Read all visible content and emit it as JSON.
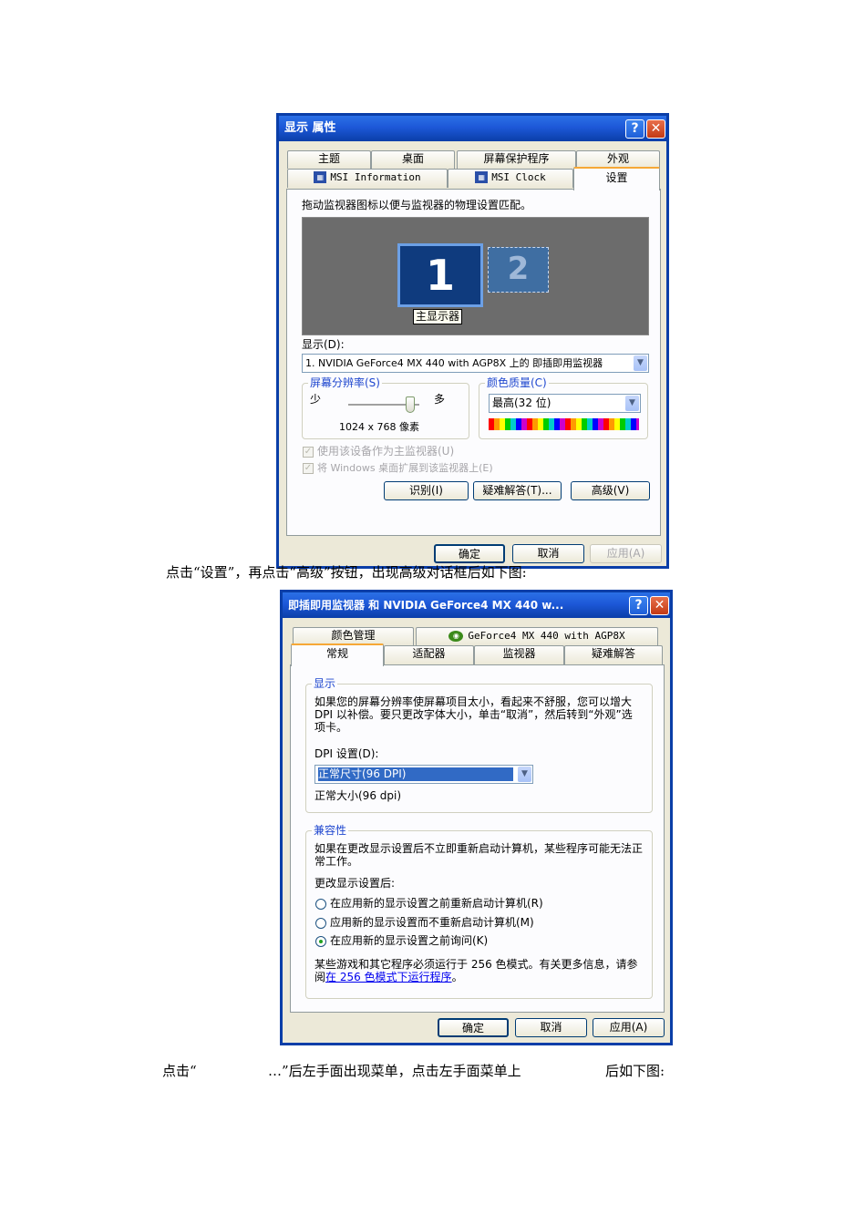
{
  "dialog1": {
    "title": "显示 属性",
    "help_icon": "?",
    "close_icon": "✕",
    "tabs_row1": [
      "主题",
      "桌面",
      "屏幕保护程序",
      "外观"
    ],
    "tabs_row2": [
      "MSI Information",
      "MSI Clock",
      "设置"
    ],
    "instruction": "拖动监视器图标以便与监视器的物理设置匹配。",
    "monitor1_number": "1",
    "monitor2_number": "2",
    "primary_label": "主显示器",
    "display_label": "显示(D):",
    "display_value": "1. NVIDIA GeForce4 MX 440 with AGP8X 上的 即插即用监视器",
    "resolution": {
      "legend": "屏幕分辨率(S)",
      "less": "少",
      "more": "多",
      "value": "1024 x 768 像素"
    },
    "color_quality": {
      "legend": "颜色质量(C)",
      "value": "最高(32 位)"
    },
    "checkbox_primary": "使用该设备作为主监视器(U)",
    "checkbox_extend": "将 Windows 桌面扩展到该监视器上(E)",
    "buttons": {
      "identify": "识别(I)",
      "troubleshoot": "疑难解答(T)...",
      "advanced": "高级(V)",
      "ok": "确定",
      "cancel": "取消",
      "apply": "应用(A)"
    }
  },
  "doc": {
    "line1": "点击“设置”，再点击“高级”按钮，出现高级对话框后如下图:",
    "line2_part1": "点击“",
    "line2_part2": "…”后左手面出现菜单，点击左手面菜单上",
    "line2_part3": "后如下图:"
  },
  "dialog2": {
    "title": "即插即用监视器 和 NVIDIA GeForce4 MX 440 w...",
    "help_icon": "?",
    "close_icon": "✕",
    "tabs_row1": [
      "颜色管理",
      "GeForce4 MX 440 with AGP8X"
    ],
    "tabs_row2": [
      "常规",
      "适配器",
      "监视器",
      "疑难解答"
    ],
    "display_group": {
      "legend": "显示",
      "text": "如果您的屏幕分辨率使屏幕项目太小，看起来不舒服，您可以增大 DPI 以补偿。要只更改字体大小，单击“取消”，然后转到“外观”选项卡。",
      "dpi_label": "DPI 设置(D):",
      "dpi_value": "正常尺寸(96 DPI)",
      "dpi_note": "正常大小(96 dpi)"
    },
    "compat_group": {
      "legend": "兼容性",
      "text": "如果在更改显示设置后不立即重新启动计算机，某些程序可能无法正常工作。",
      "after_label": "更改显示设置后:",
      "options": [
        "在应用新的显示设置之前重新启动计算机(R)",
        "应用新的显示设置而不重新启动计算机(M)",
        "在应用新的显示设置之前询问(K)"
      ],
      "selected_index": 2,
      "footer_text": "某些游戏和其它程序必须运行于 256 色模式。有关更多信息，请参阅",
      "footer_link": "在 256 色模式下运行程序",
      "footer_end": "。"
    },
    "buttons": {
      "ok": "确定",
      "cancel": "取消",
      "apply": "应用(A)"
    }
  }
}
